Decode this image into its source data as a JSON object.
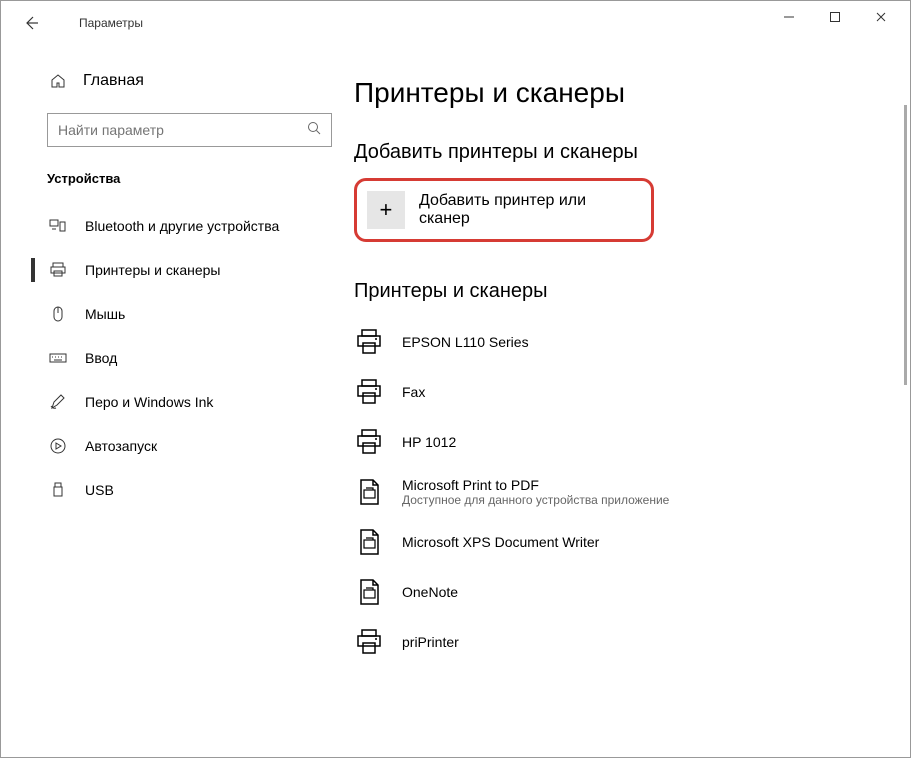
{
  "window": {
    "title": "Параметры"
  },
  "sidebar": {
    "home_label": "Главная",
    "search_placeholder": "Найти параметр",
    "category": "Устройства",
    "items": [
      {
        "label": "Bluetooth и другие устройства"
      },
      {
        "label": "Принтеры и сканеры"
      },
      {
        "label": "Мышь"
      },
      {
        "label": "Ввод"
      },
      {
        "label": "Перо и Windows Ink"
      },
      {
        "label": "Автозапуск"
      },
      {
        "label": "USB"
      }
    ]
  },
  "main": {
    "page_title": "Принтеры и сканеры",
    "add_section_title": "Добавить принтеры и сканеры",
    "add_button_label": "Добавить принтер или сканер",
    "list_section_title": "Принтеры и сканеры",
    "printers": [
      {
        "name": "EPSON L110 Series",
        "sub": ""
      },
      {
        "name": "Fax",
        "sub": ""
      },
      {
        "name": "HP 1012",
        "sub": ""
      },
      {
        "name": "Microsoft Print to PDF",
        "sub": "Доступное для данного устройства приложение"
      },
      {
        "name": "Microsoft XPS Document Writer",
        "sub": ""
      },
      {
        "name": "OneNote",
        "sub": ""
      },
      {
        "name": "priPrinter",
        "sub": ""
      }
    ]
  }
}
